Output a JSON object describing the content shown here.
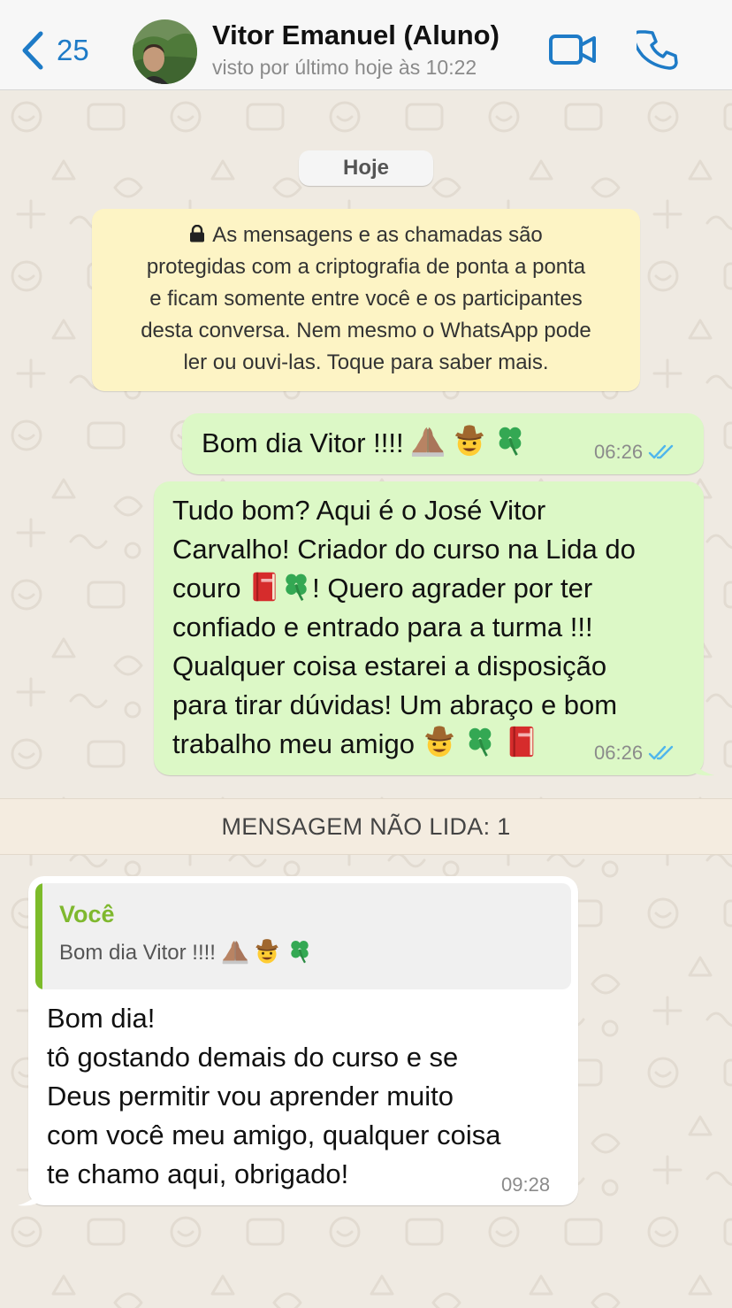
{
  "header": {
    "back_count": "25",
    "contact_name": "Vitor Emanuel (Aluno)",
    "last_seen": "visto por último hoje às 10:22"
  },
  "date_chip": "Hoje",
  "encryption_notice": {
    "lines": [
      "As mensagens e as chamadas são",
      "protegidas com a criptografia de ponta a ponta",
      "e ficam somente entre você e os participantes",
      "desta conversa. Nem mesmo o WhatsApp pode",
      "ler ou ouvi-las. Toque para saber mais."
    ]
  },
  "messages": [
    {
      "direction": "outgoing",
      "text": "Bom dia Vitor !!!!",
      "time": "06:26",
      "status": "read"
    },
    {
      "direction": "outgoing",
      "lines": [
        "Tudo bom? Aqui é o José Vitor",
        "Carvalho!  Criador do curso na Lida do",
        "couro",
        "! Quero agrader por ter",
        "confiado e entrado para a turma !!!",
        "Qualquer coisa estarei a disposição",
        "para tirar dúvidas! Um abraço e bom",
        "trabalho meu amigo"
      ],
      "time": "06:26",
      "status": "read"
    },
    {
      "direction": "incoming",
      "quote": {
        "author": "Você",
        "text": "Bom dia Vitor !!!!"
      },
      "lines": [
        "Bom dia!",
        "tô gostando demais do curso e se",
        "Deus permitir vou aprender muito",
        "com você meu amigo, qualquer coisa",
        "te chamo aqui, obrigado!"
      ],
      "time": "09:28"
    }
  ],
  "unread_divider": "MENSAGEM NÃO LIDA: 1",
  "colors": {
    "accent_blue": "#1e7bc7",
    "outgoing_bubble": "#dcf8c6",
    "incoming_bubble": "#ffffff",
    "read_ticks": "#4fb6ec",
    "quote_author": "#7fb82e"
  },
  "icons": [
    "back-chevron-icon",
    "video-call-icon",
    "phone-call-icon",
    "lock-icon",
    "double-check-icon",
    "folded-hands-emoji",
    "cowboy-emoji",
    "four-leaf-clover-emoji",
    "red-book-emoji"
  ]
}
